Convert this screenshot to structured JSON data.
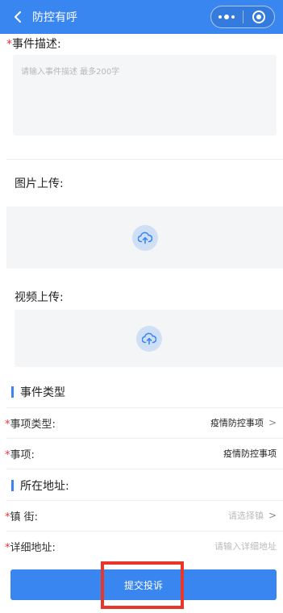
{
  "navbar": {
    "title": "防控有呼"
  },
  "description": {
    "required_mark": "*",
    "label": "事件描述:",
    "placeholder": "请输入事件描述 最多200字"
  },
  "image_upload": {
    "label": "图片上传:"
  },
  "video_upload": {
    "label": "视频上传:"
  },
  "event_type_section": {
    "title": "事件类型"
  },
  "item_type": {
    "required_mark": "*",
    "label": "事项类型:",
    "value": "疫情防控事项",
    "chevron": ">"
  },
  "item": {
    "required_mark": "*",
    "label": "事项:",
    "value": "疫情防控事项"
  },
  "address_section": {
    "title": "所在地址:"
  },
  "town": {
    "required_mark": "*",
    "label": "镇 街:",
    "placeholder": "请选择镇",
    "chevron": ">"
  },
  "detail_address": {
    "required_mark": "*",
    "label": "详细地址:",
    "placeholder": "请输入详细地址"
  },
  "submit": {
    "label": "提交投诉"
  },
  "colors": {
    "primary": "#3a86f0",
    "required": "#e33333",
    "highlight": "#e8362a"
  },
  "icons": {
    "back": "chevron-left-icon",
    "more": "more-dots-icon",
    "close": "target-circle-icon",
    "upload": "cloud-upload-icon"
  }
}
